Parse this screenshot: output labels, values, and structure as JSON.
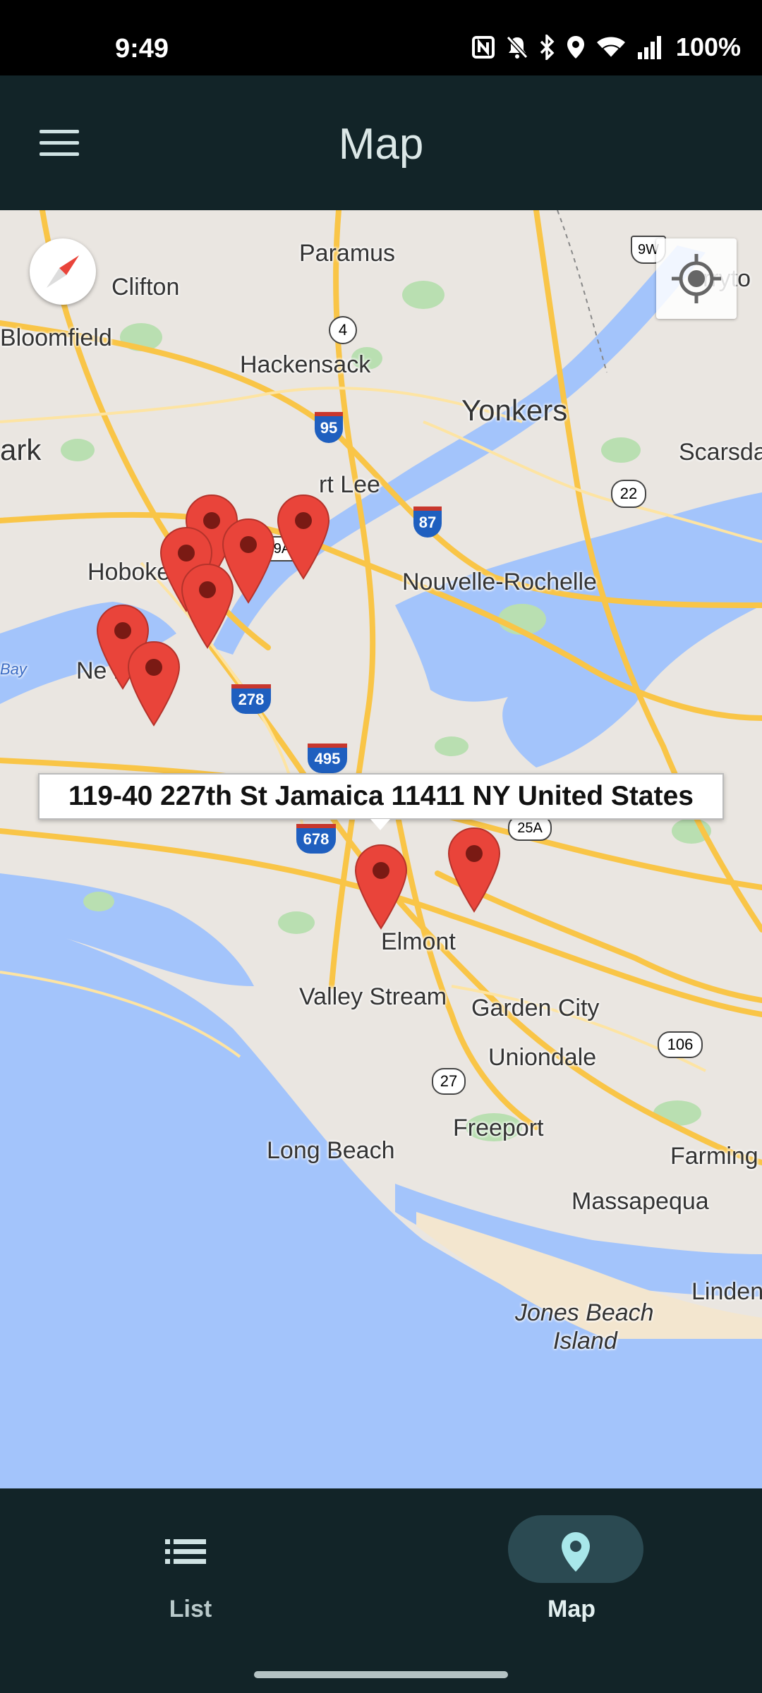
{
  "status_bar": {
    "time": "9:49",
    "battery": "100%"
  },
  "app_bar": {
    "title": "Map"
  },
  "map": {
    "place_labels": {
      "paramus": "Paramus",
      "clifton": "Clifton",
      "bloomfield": "Bloomfield",
      "hackensack": "Hackensack",
      "yonkers": "Yonkers",
      "scarsdale": "Scarsda",
      "ark": "ark",
      "fort_lee": "rt Lee",
      "hoboken": "Hoboken",
      "nouvelle_rochelle": "Nouvelle-Rochelle",
      "newark": "Ne     k",
      "bay": "Bay",
      "elmont": "Elmont",
      "valley_stream": "Valley Stream",
      "garden_city": "Garden City",
      "uniondale": "Uniondale",
      "freeport": "Freeport",
      "long_beach": "Long Beach",
      "farming": "Farming",
      "massapequa": "Massapequa",
      "linden": "Linden",
      "jones_beach": "Jones Beach",
      "island": "Island",
      "tarrytown": "rryto"
    },
    "route_shields": {
      "r4": "4",
      "i95": "95",
      "i87": "87",
      "r22": "22",
      "r9w": "9W",
      "r9a": "9A",
      "i278": "278",
      "i495": "495",
      "i678": "678",
      "r25a": "25A",
      "r27": "27",
      "r106": "106"
    },
    "info_window": {
      "address": "119-40 227th St Jamaica 11411 NY United States"
    },
    "marker_count": 10,
    "colors": {
      "water": "#a3c4fb",
      "land": "#eae6e1",
      "highway": "#f9c547",
      "marker": "#e9443a",
      "park": "#b9dfb1"
    }
  },
  "bottom_nav": {
    "items": [
      {
        "label": "List",
        "icon": "list-icon",
        "selected": false
      },
      {
        "label": "Map",
        "icon": "map-pin-icon",
        "selected": true
      }
    ]
  }
}
